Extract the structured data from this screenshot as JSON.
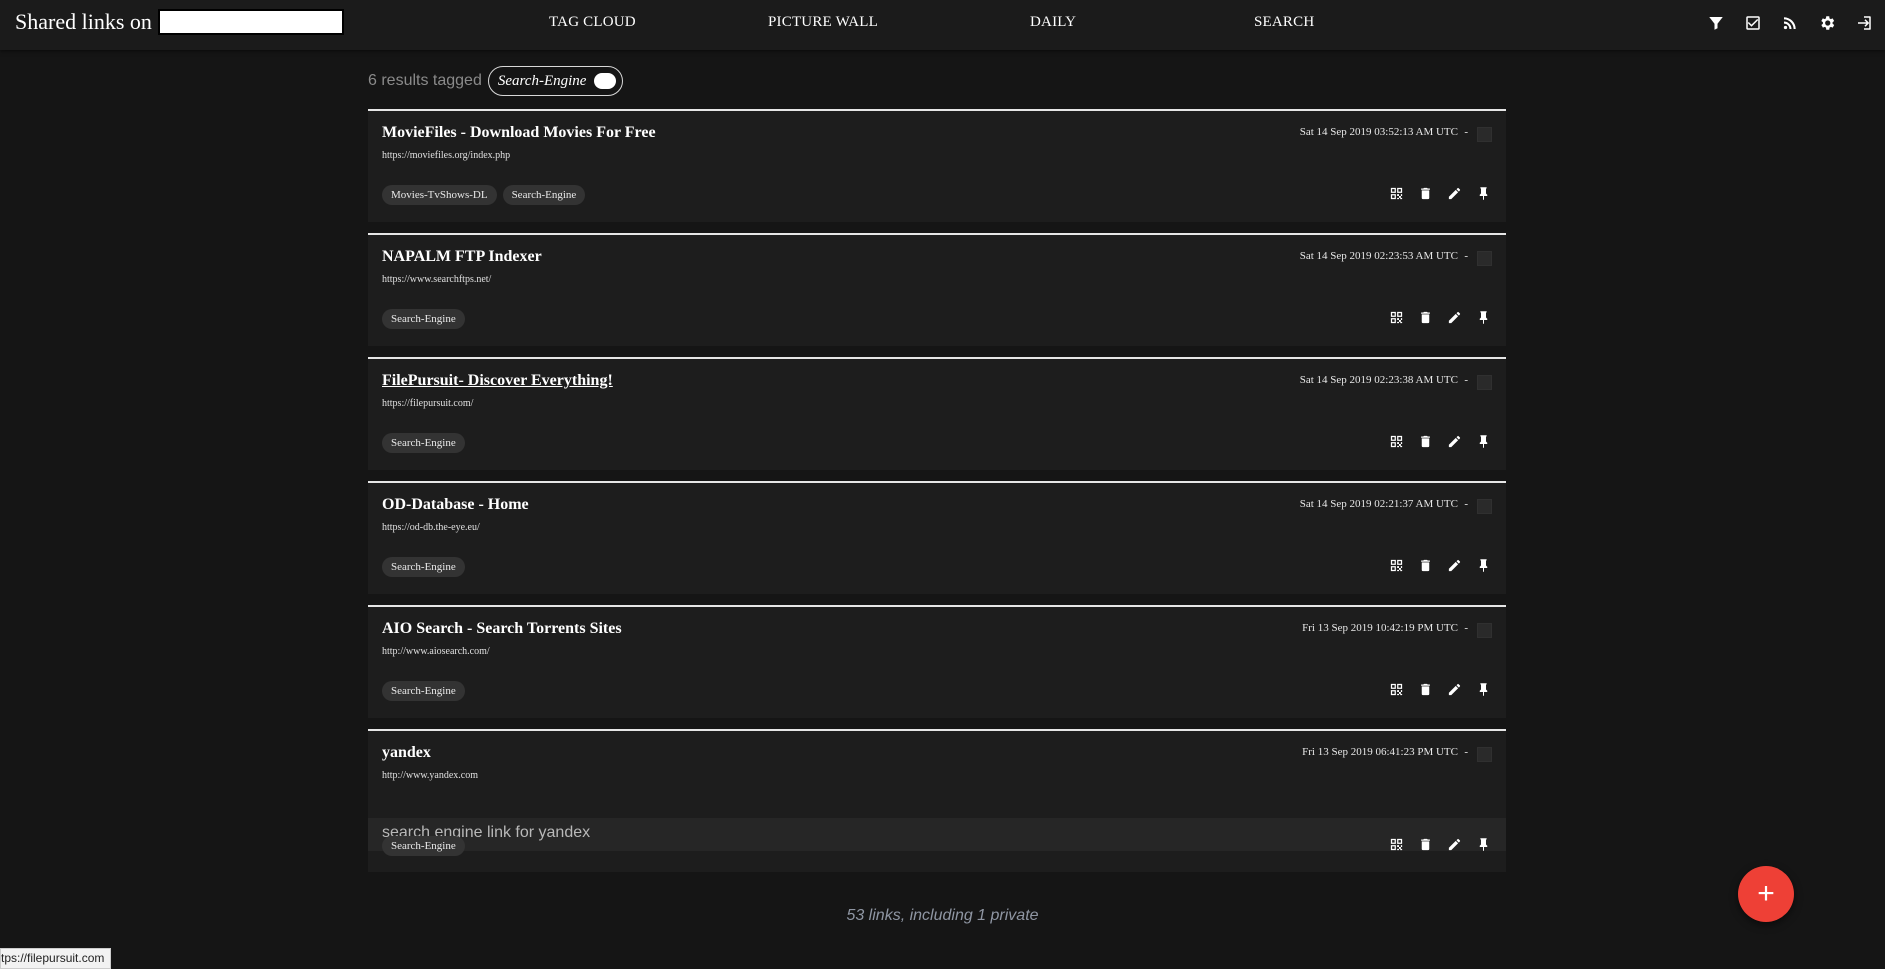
{
  "header": {
    "brand_prefix": "Shared links on",
    "nav": [
      "TAG CLOUD",
      "PICTURE WALL",
      "DAILY",
      "SEARCH"
    ],
    "tools": [
      "filter-icon",
      "checkbox-icon",
      "rss-icon",
      "gear-icon",
      "logout-icon"
    ]
  },
  "search": {
    "summary": "6 results tagged",
    "tag": "Search-Engine"
  },
  "links": [
    {
      "title": "MovieFiles - Download Movies For Free",
      "url": "https://moviefiles.org/index.php",
      "date": "Sat 14 Sep 2019 03:52:13 AM UTC",
      "tags": [
        "Movies-TvShows-DL",
        "Search-Engine"
      ],
      "description": ""
    },
    {
      "title": "NAPALM FTP Indexer",
      "url": "https://www.searchftps.net/",
      "date": "Sat 14 Sep 2019 02:23:53 AM UTC",
      "tags": [
        "Search-Engine"
      ],
      "description": ""
    },
    {
      "title": "FilePursuit- Discover Everything!",
      "url": "https://filepursuit.com/",
      "date": "Sat 14 Sep 2019 02:23:38 AM UTC",
      "tags": [
        "Search-Engine"
      ],
      "description": ""
    },
    {
      "title": "OD-Database - Home",
      "url": "https://od-db.the-eye.eu/",
      "date": "Sat 14 Sep 2019 02:21:37 AM UTC",
      "tags": [
        "Search-Engine"
      ],
      "description": ""
    },
    {
      "title": "AIO Search - Search Torrents Sites",
      "url": "http://www.aiosearch.com/",
      "date": "Fri 13 Sep 2019 10:42:19 PM UTC",
      "tags": [
        "Search-Engine"
      ],
      "description": ""
    },
    {
      "title": "yandex",
      "url": "http://www.yandex.com",
      "date": "Fri 13 Sep 2019 06:41:23 PM UTC",
      "tags": [
        "Search-Engine"
      ],
      "description": "search engine link for yandex"
    }
  ],
  "separator": "-",
  "footer": {
    "count": "53 links, including 1 private"
  },
  "fab": {
    "label": "+"
  },
  "status_bar": {
    "url": "tps://filepursuit.com"
  }
}
